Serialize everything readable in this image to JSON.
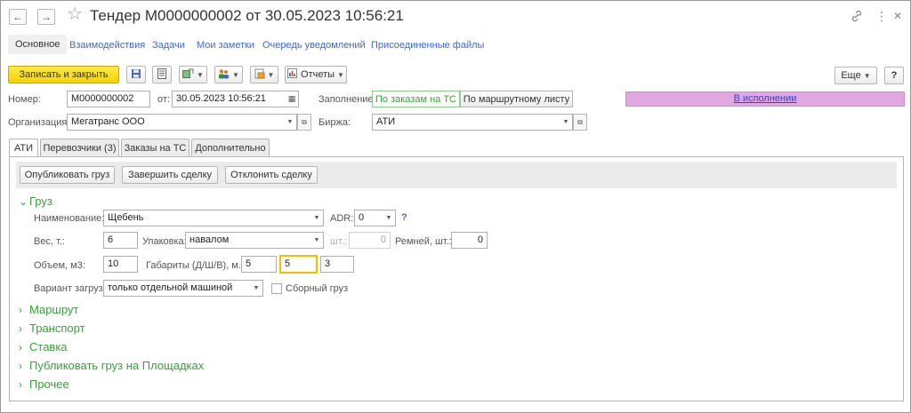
{
  "window": {
    "title": "Тендер М0000000002 от 30.05.2023 10:56:21",
    "back_icon": "←",
    "forward_icon": "→",
    "star_icon": "☆",
    "link_icon": "🔗",
    "more_icon": "⋮",
    "close_icon": "✕"
  },
  "nav": {
    "items": [
      {
        "label": "Основное"
      },
      {
        "label": "Взаимодействия"
      },
      {
        "label": "Задачи"
      },
      {
        "label": "Мои заметки"
      },
      {
        "label": "Очередь уведомлений"
      },
      {
        "label": "Присоединенные файлы"
      }
    ]
  },
  "toolbar": {
    "save_close_label": "Записать и закрыть",
    "reports_label": "Отчеты",
    "more_label": "Еще",
    "help_label": "?"
  },
  "header": {
    "number_label": "Номер:",
    "number_value": "М0000000002",
    "date_label": "от:",
    "date_value": "30.05.2023 10:56:21",
    "fill_label": "Заполнение:",
    "fill_option_1": "По заказам на ТС",
    "fill_option_2": "По маршрутному листу",
    "status": "В исполнении",
    "org_label": "Организация:",
    "org_value": "Мегатранс ООО",
    "exchange_label": "Биржа:",
    "exchange_value": "АТИ"
  },
  "tabs": [
    {
      "label": "АТИ"
    },
    {
      "label": "Перевозчики (3)"
    },
    {
      "label": "Заказы на ТС"
    },
    {
      "label": "Дополнительно"
    }
  ],
  "actions": {
    "publish_label": "Опубликовать груз",
    "complete_label": "Завершить сделку",
    "reject_label": "Отклонить сделку"
  },
  "cargo": {
    "section_label": "Груз",
    "name_label": "Наименование:",
    "name_value": "Щебень",
    "adr_label": "ADR:",
    "adr_value": "0",
    "adr_help": "?",
    "weight_label": "Вес, т.:",
    "weight_value": "6",
    "package_label": "Упаковка:",
    "package_value": "навалом",
    "pcs_label": "шт.:",
    "pcs_value": "0",
    "belts_label": "Ремней, шт.:",
    "belts_value": "0",
    "volume_label": "Объем,  м3:",
    "volume_value": "10",
    "dims_label": "Габариты (Д/Ш/В), м.:",
    "dim_l": "5",
    "dim_w": "5",
    "dim_h": "3",
    "loading_label": "Вариант загрузки",
    "loading_value": "только отдельной машиной",
    "combined_label": "Сборный груз"
  },
  "sections": [
    {
      "label": "Маршрут"
    },
    {
      "label": "Транспорт"
    },
    {
      "label": "Ставка"
    },
    {
      "label": "Публиковать груз на Площадках"
    },
    {
      "label": "Прочее"
    }
  ],
  "colors": {
    "accent_green": "#3a9f3a",
    "status_bg": "#e0a7e0",
    "primary_button": "#f5d300",
    "link_blue": "#3c6ad0"
  }
}
